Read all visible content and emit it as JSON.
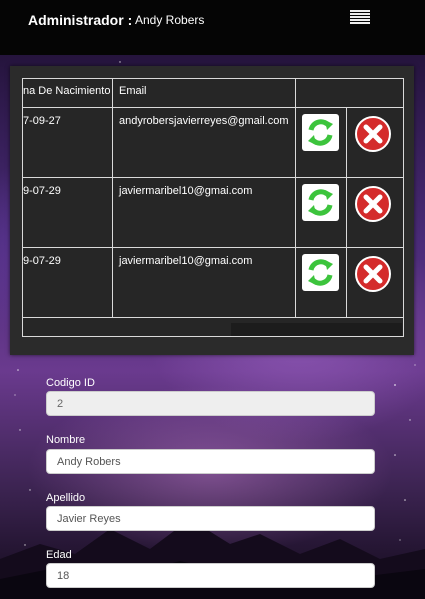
{
  "header": {
    "admin_label": "Administrador :",
    "admin_name": "Andy Robers",
    "menu_icon": "hamburger-menu-icon"
  },
  "table": {
    "columns": [
      "na De Nacimiento",
      "Email",
      ""
    ],
    "rows": [
      {
        "date": "7-09-27",
        "email": "andyrobersjavierreyes@gmail.com"
      },
      {
        "date": "9-07-29",
        "email": "javiermaribel10@gmai.com"
      },
      {
        "date": "9-07-29",
        "email": "javiermaribel10@gmai.com"
      }
    ],
    "edit_icon": "refresh-icon",
    "delete_icon": "delete-icon",
    "colors": {
      "edit_green": "#3cc43c",
      "delete_red": "#d42b2b"
    }
  },
  "form": {
    "id_label": "Codigo ID",
    "id_value": "2",
    "nombre_label": "Nombre",
    "nombre_value": "Andy Robers",
    "apellido_label": "Apellido",
    "apellido_value": "Javier Reyes",
    "edad_label": "Edad",
    "edad_value": "18"
  }
}
